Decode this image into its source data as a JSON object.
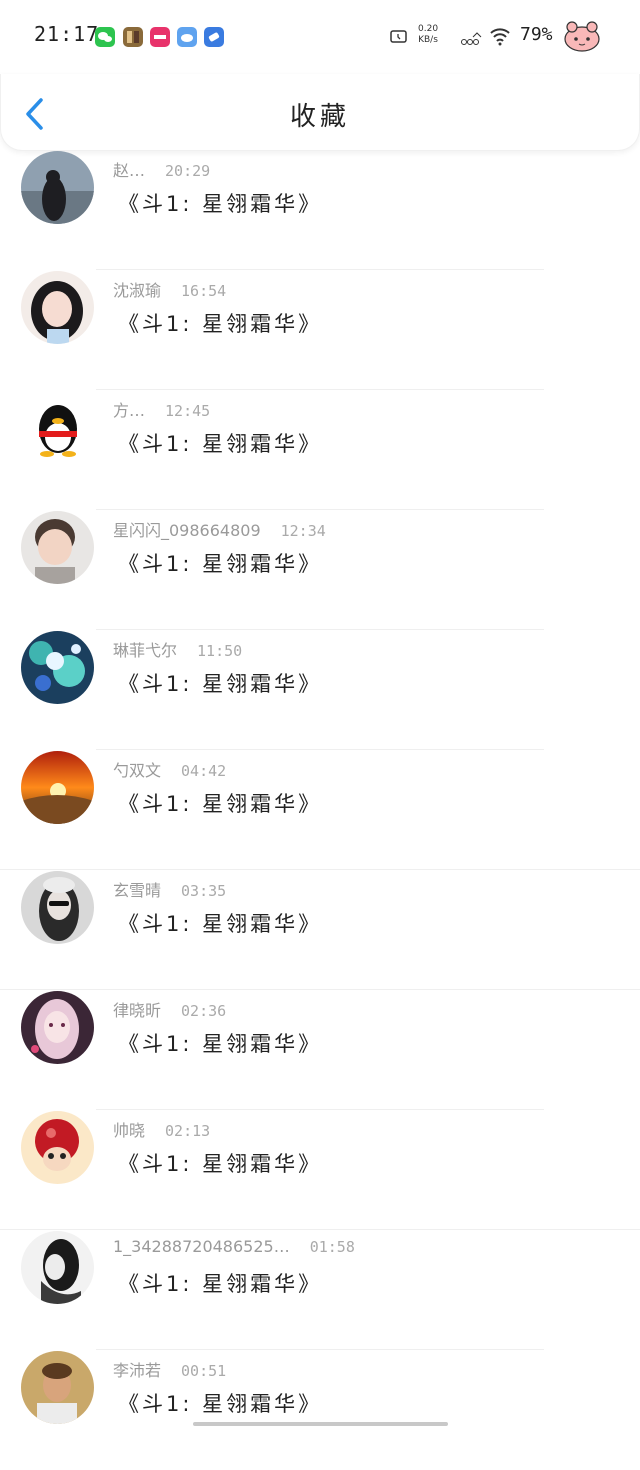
{
  "status": {
    "time": "21:17",
    "net_speed_value": "0.20",
    "net_speed_unit": "KB/s",
    "battery": "79%",
    "app_icons": [
      "wechat-icon",
      "game-icon",
      "music-icon",
      "cloud-icon",
      "browser-icon"
    ]
  },
  "header": {
    "back_icon": "chevron-left-icon",
    "title": "收藏"
  },
  "items": [
    {
      "name": "赵…",
      "time": "20:29",
      "message": "《斗1: 星翎霜华》"
    },
    {
      "name": "沈淑瑜",
      "time": "16:54",
      "message": "《斗1: 星翎霜华》"
    },
    {
      "name": "方…",
      "time": "12:45",
      "message": "《斗1: 星翎霜华》"
    },
    {
      "name": "星闪闪_098664809",
      "time": "12:34",
      "message": "《斗1: 星翎霜华》"
    },
    {
      "name": "琳菲弋尔",
      "time": "11:50",
      "message": "《斗1: 星翎霜华》"
    },
    {
      "name": "勺双文",
      "time": "04:42",
      "message": "《斗1: 星翎霜华》"
    },
    {
      "name": "玄雪晴",
      "time": "03:35",
      "message": "《斗1: 星翎霜华》"
    },
    {
      "name": "律晓昕",
      "time": "02:36",
      "message": "《斗1: 星翎霜华》"
    },
    {
      "name": "帅晓",
      "time": "02:13",
      "message": "《斗1: 星翎霜华》"
    },
    {
      "name": "1_34288720486525…",
      "time": "01:58",
      "message": "《斗1: 星翎霜华》"
    },
    {
      "name": "李沛若",
      "time": "00:51",
      "message": "《斗1: 星翎霜华》"
    }
  ],
  "colors": {
    "accent": "#2a8ee8",
    "meta_text": "#9a9a9a"
  }
}
